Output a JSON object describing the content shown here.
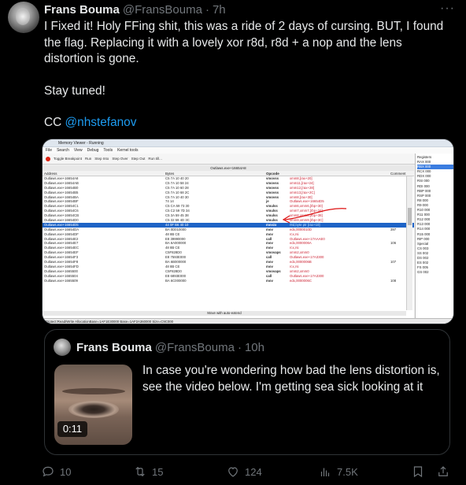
{
  "tweet": {
    "author_name": "Frans Bouma",
    "handle": "@FransBouma",
    "separator": "·",
    "time": "7h",
    "more_label": "···",
    "text_line1": "I Fixed it! Holy FFing shit, this was a ride of 2 days of cursing. BUT, I found the flag. Replacing it with a lovely xor r8d, r8d + a nop and the lens distortion is gone.",
    "text_line2": "Stay tuned!",
    "cc_prefix": "CC ",
    "cc_mention": "@nhstefanov"
  },
  "screenshot": {
    "window_title": "Memory Viewer - Running",
    "menu": [
      "File",
      "Search",
      "View",
      "Debug",
      "Tools",
      "Kernel tools"
    ],
    "toolbar": [
      "Toggle Breakpoint",
      "Run",
      "Step Into",
      "Step Over",
      "Step Out",
      "Run till..."
    ],
    "file_tab": "Outlaws.exe+16654A8",
    "columns": [
      "Address",
      "Bytes",
      "Opcode",
      "",
      "Comment"
    ],
    "rows": [
      {
        "addr": "Outlaws.exe+16654A8",
        "bytes": "C5 7A 10 40 20",
        "op": "vmovss",
        "arg": "xmm8,[rax+20]",
        "cmt": ""
      },
      {
        "addr": "Outlaws.exe+16654AB",
        "bytes": "C5 7A 10 58 24",
        "op": "vmovss",
        "arg": "xmm11,[rax+24]",
        "cmt": ""
      },
      {
        "addr": "Outlaws.exe+16654B0",
        "bytes": "C5 7A 10 60 28",
        "op": "vmovss",
        "arg": "xmm12,[rax+28]",
        "cmt": ""
      },
      {
        "addr": "Outlaws.exe+16654B5",
        "bytes": "C5 7A 10 68 2C",
        "op": "vmovss",
        "arg": "xmm13,[rax+2C]",
        "cmt": ""
      },
      {
        "addr": "Outlaws.exe+16654BA",
        "bytes": "C5 7A 10 40 30",
        "op": "vmovss",
        "arg": "xmm8,[rax+30]",
        "cmt": ""
      },
      {
        "addr": "Outlaws.exe+16654BF",
        "bytes": "74 14",
        "op": "je",
        "arg": "Outlaws.exe+16654D5",
        "cmt": ""
      },
      {
        "addr": "Outlaws.exe+16654C1",
        "bytes": "C5 CA 59 73 30",
        "op": "vmulss",
        "arg": "xmm6,xmm6,[rbp+30]",
        "cmt": ""
      },
      {
        "addr": "Outlaws.exe+16654C6",
        "bytes": "C5 C2 59 7D 34",
        "op": "vmulss",
        "arg": "xmm7,xmm7,[rbp+34]",
        "cmt": ""
      },
      {
        "addr": "Outlaws.exe+16654CB",
        "bytes": "C5 3A 59 45 38",
        "op": "vmulss",
        "arg": "xmm8,xmm8,[rbp+38]",
        "cmt": ""
      },
      {
        "addr": "Outlaws.exe+16654D0",
        "bytes": "C5 32 59 4D 3C",
        "op": "vmulss",
        "arg": "xmm9,xmm9,[rbp+3C]",
        "cmt": ""
      },
      {
        "addr": "Outlaws.exe+16654D5",
        "bytes": "44 0F B6 40 10",
        "op": "movzx",
        "arg": "r8d,byte ptr [rax+10]",
        "cmt": "",
        "sel": true
      },
      {
        "addr": "Outlaws.exe+16654DA",
        "bytes": "BA 0D010000",
        "op": "mov",
        "arg": "edx,0000010D",
        "cmt": "397"
      },
      {
        "addr": "Outlaws.exe+16654DF",
        "bytes": "48 8B CE",
        "op": "mov",
        "arg": "rcx,rsi",
        "cmt": ""
      },
      {
        "addr": "Outlaws.exe+16654E2",
        "bytes": "E8 39990000",
        "op": "call",
        "arg": "Outlaws.exe+17AAAE0",
        "cmt": ""
      },
      {
        "addr": "Outlaws.exe+16654E7",
        "bytes": "BA 6A000000",
        "op": "mov",
        "arg": "edx,0000006A",
        "cmt": "106"
      },
      {
        "addr": "Outlaws.exe+16654EC",
        "bytes": "48 8B CE",
        "op": "mov",
        "arg": "rcx,rsi",
        "cmt": ""
      },
      {
        "addr": "Outlaws.exe+16654EF",
        "bytes": "C5F828D0",
        "op": "vmovaps",
        "arg": "xmm2,xmm0",
        "cmt": ""
      },
      {
        "addr": "Outlaws.exe+16654F3",
        "bytes": "E8 7593E000",
        "op": "call",
        "arg": "Outlaws.exe+17A3300",
        "cmt": ""
      },
      {
        "addr": "Outlaws.exe+16654F8",
        "bytes": "BA 6B000000",
        "op": "mov",
        "arg": "edx,0000006B",
        "cmt": "107"
      },
      {
        "addr": "Outlaws.exe+16654FD",
        "bytes": "48 8B CE",
        "op": "mov",
        "arg": "rcx,rsi",
        "cmt": ""
      },
      {
        "addr": "Outlaws.exe+1665500",
        "bytes": "C5F828D0",
        "op": "vmovaps",
        "arg": "xmm2,xmm0",
        "cmt": ""
      },
      {
        "addr": "Outlaws.exe+1665504",
        "bytes": "E8 6893E000",
        "op": "call",
        "arg": "Outlaws.exe+17A3300",
        "cmt": ""
      },
      {
        "addr": "Outlaws.exe+1665509",
        "bytes": "BA 6C000000",
        "op": "mov",
        "arg": "edx,0000006C",
        "cmt": "108"
      }
    ],
    "more_row": "Move with auto-extend",
    "status": "Protect:Read/Write  AllocationBase=1AF1E30000 Base=1AF2A360000 Size=C9C000",
    "regs": [
      "Registers",
      "RAX 000",
      "RBX 000",
      "RCX 000",
      "RDX 000",
      "RSI 000",
      "RDI 000",
      "RBP 000",
      "RSP 000",
      "R8 000",
      "R9 000",
      "R10 000",
      "R11 000",
      "R12 000",
      "R13 000",
      "R14 000",
      "R15 000",
      "RIP 000",
      "Special",
      "CS 003",
      "SS 002",
      "DS 002",
      "ES 002",
      "FS 005",
      "GS 002"
    ]
  },
  "quote": {
    "author_name": "Frans Bouma",
    "handle": "@FransBouma",
    "separator": "·",
    "time": "10h",
    "text": "In case you're wondering how bad the lens distortion is, see the video below. I'm getting sea sick looking at it",
    "video_duration": "0:11"
  },
  "actions": {
    "replies": "10",
    "retweets": "15",
    "likes": "124",
    "views": "7.5K"
  }
}
